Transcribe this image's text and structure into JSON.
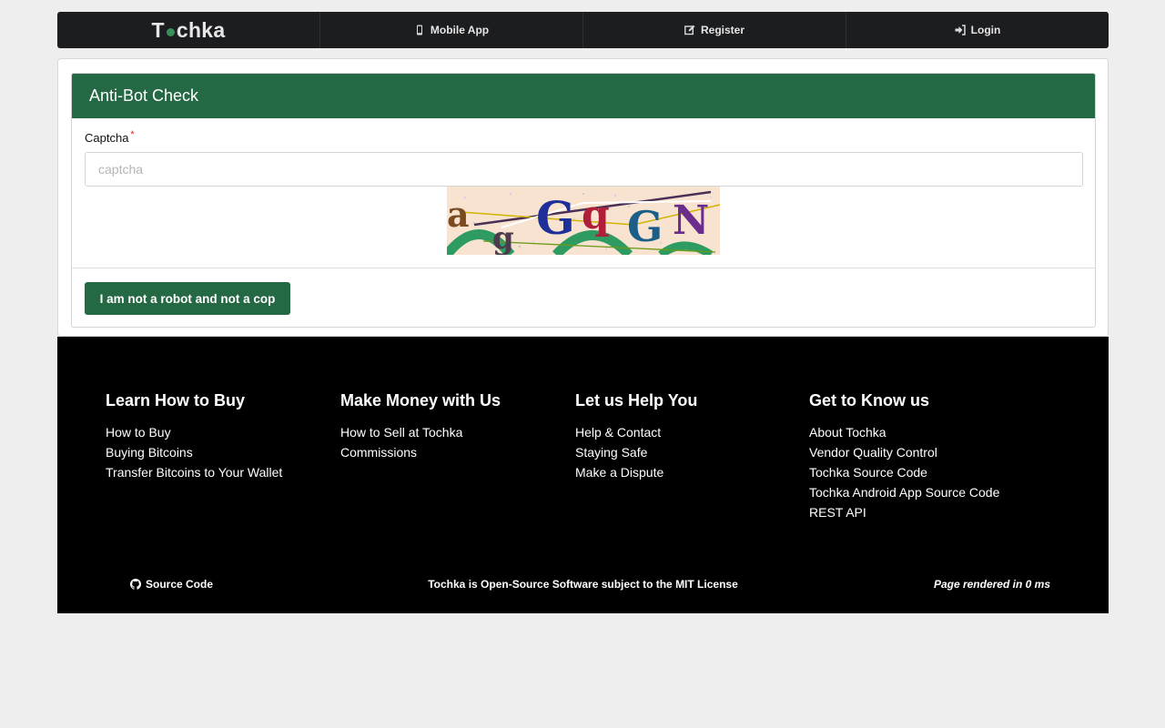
{
  "nav": {
    "logo_left": "T",
    "logo_right": "chka",
    "items": [
      {
        "label": "Mobile App",
        "icon": "mobile-icon"
      },
      {
        "label": "Register",
        "icon": "edit-icon"
      },
      {
        "label": "Login",
        "icon": "sign-in-icon"
      }
    ]
  },
  "card": {
    "title": "Anti-Bot Check",
    "field_label": "Captcha",
    "required_mark": "*",
    "input_placeholder": "captcha",
    "input_value": "",
    "submit_label": "I am not a robot and not a cop"
  },
  "footer": {
    "columns": [
      {
        "title": "Learn How to Buy",
        "links": [
          "How to Buy",
          "Buying Bitcoins",
          "Transfer Bitcoins to Your Wallet"
        ]
      },
      {
        "title": "Make Money with Us",
        "links": [
          "How to Sell at Tochka",
          "Commissions"
        ]
      },
      {
        "title": "Let us Help You",
        "links": [
          "Help & Contact",
          "Staying Safe",
          "Make a Dispute"
        ]
      },
      {
        "title": "Get to Know us",
        "links": [
          "About Tochka",
          "Vendor Quality Control",
          "Tochka Source Code",
          "Tochka Android App Source Code",
          "REST API"
        ]
      }
    ],
    "source_code": "Source Code",
    "license": "Tochka is Open-Source Software subject to the MIT License",
    "rendered": "Page rendered in 0 ms"
  },
  "colors": {
    "brand_green": "#256944",
    "nav_bg": "#1c1d1f",
    "footer_bg": "#000000",
    "page_bg": "#eeeeee"
  }
}
